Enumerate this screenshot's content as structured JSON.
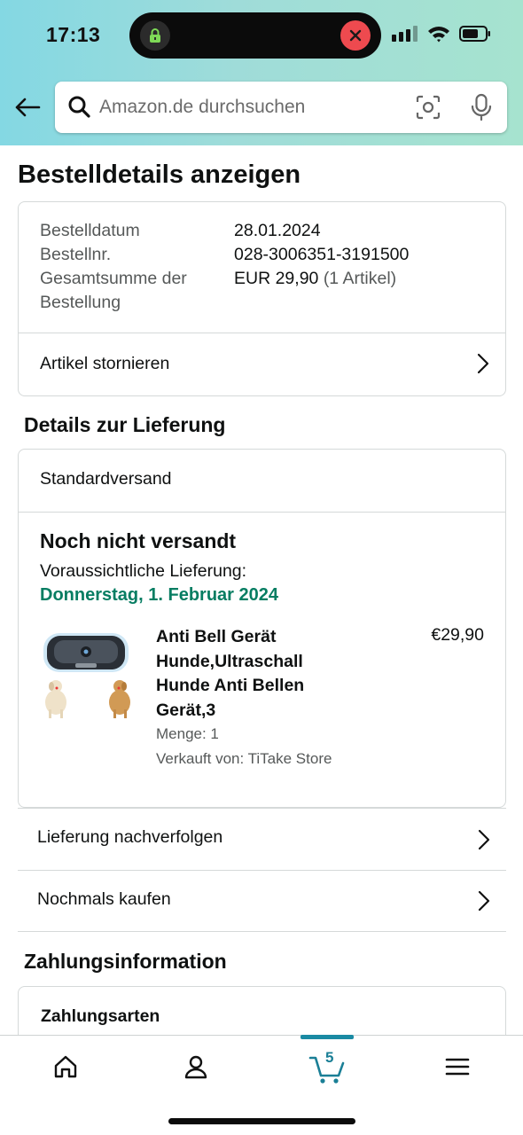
{
  "status_bar": {
    "time": "17:13"
  },
  "search": {
    "placeholder": "Amazon.de durchsuchen"
  },
  "page_title": "Bestelldetails anzeigen",
  "order": {
    "date_label": "Bestelldatum",
    "date_value": "28.01.2024",
    "number_label": "Bestellnr.",
    "number_value": "028-3006351-3191500",
    "total_label_line1": "Gesamtsumme der",
    "total_label_line2": "Bestellung",
    "total_amount": "EUR 29,90",
    "total_items": "(1 Artikel)",
    "cancel_label": "Artikel stornieren"
  },
  "delivery": {
    "section_title": "Details zur Lieferung",
    "shipping_method": "Standardversand",
    "status": "Noch nicht versandt",
    "estimate_label": "Voraussichtliche Lieferung:",
    "estimate_date": "Donnerstag, 1. Februar 2024",
    "product": {
      "title_lines": [
        "Anti Bell Gerät",
        "Hunde,Ultraschall",
        "Hunde Anti Bellen",
        "Gerät,3"
      ],
      "price": "€29,90",
      "quantity": "Menge: 1",
      "seller": "Verkauft von: TiTake Store"
    },
    "track_label": "Lieferung nachverfolgen",
    "buy_again_label": "Nochmals kaufen"
  },
  "payment": {
    "section_title": "Zahlungsinformation",
    "methods_title": "Zahlungsarten"
  },
  "tabbar": {
    "cart_count": "5",
    "accent_color": "#1a8aa3"
  },
  "colors": {
    "delivery_date": "#067d62",
    "header_gradient_start": "#84d8e3",
    "header_gradient_end": "#a6e3cf"
  }
}
